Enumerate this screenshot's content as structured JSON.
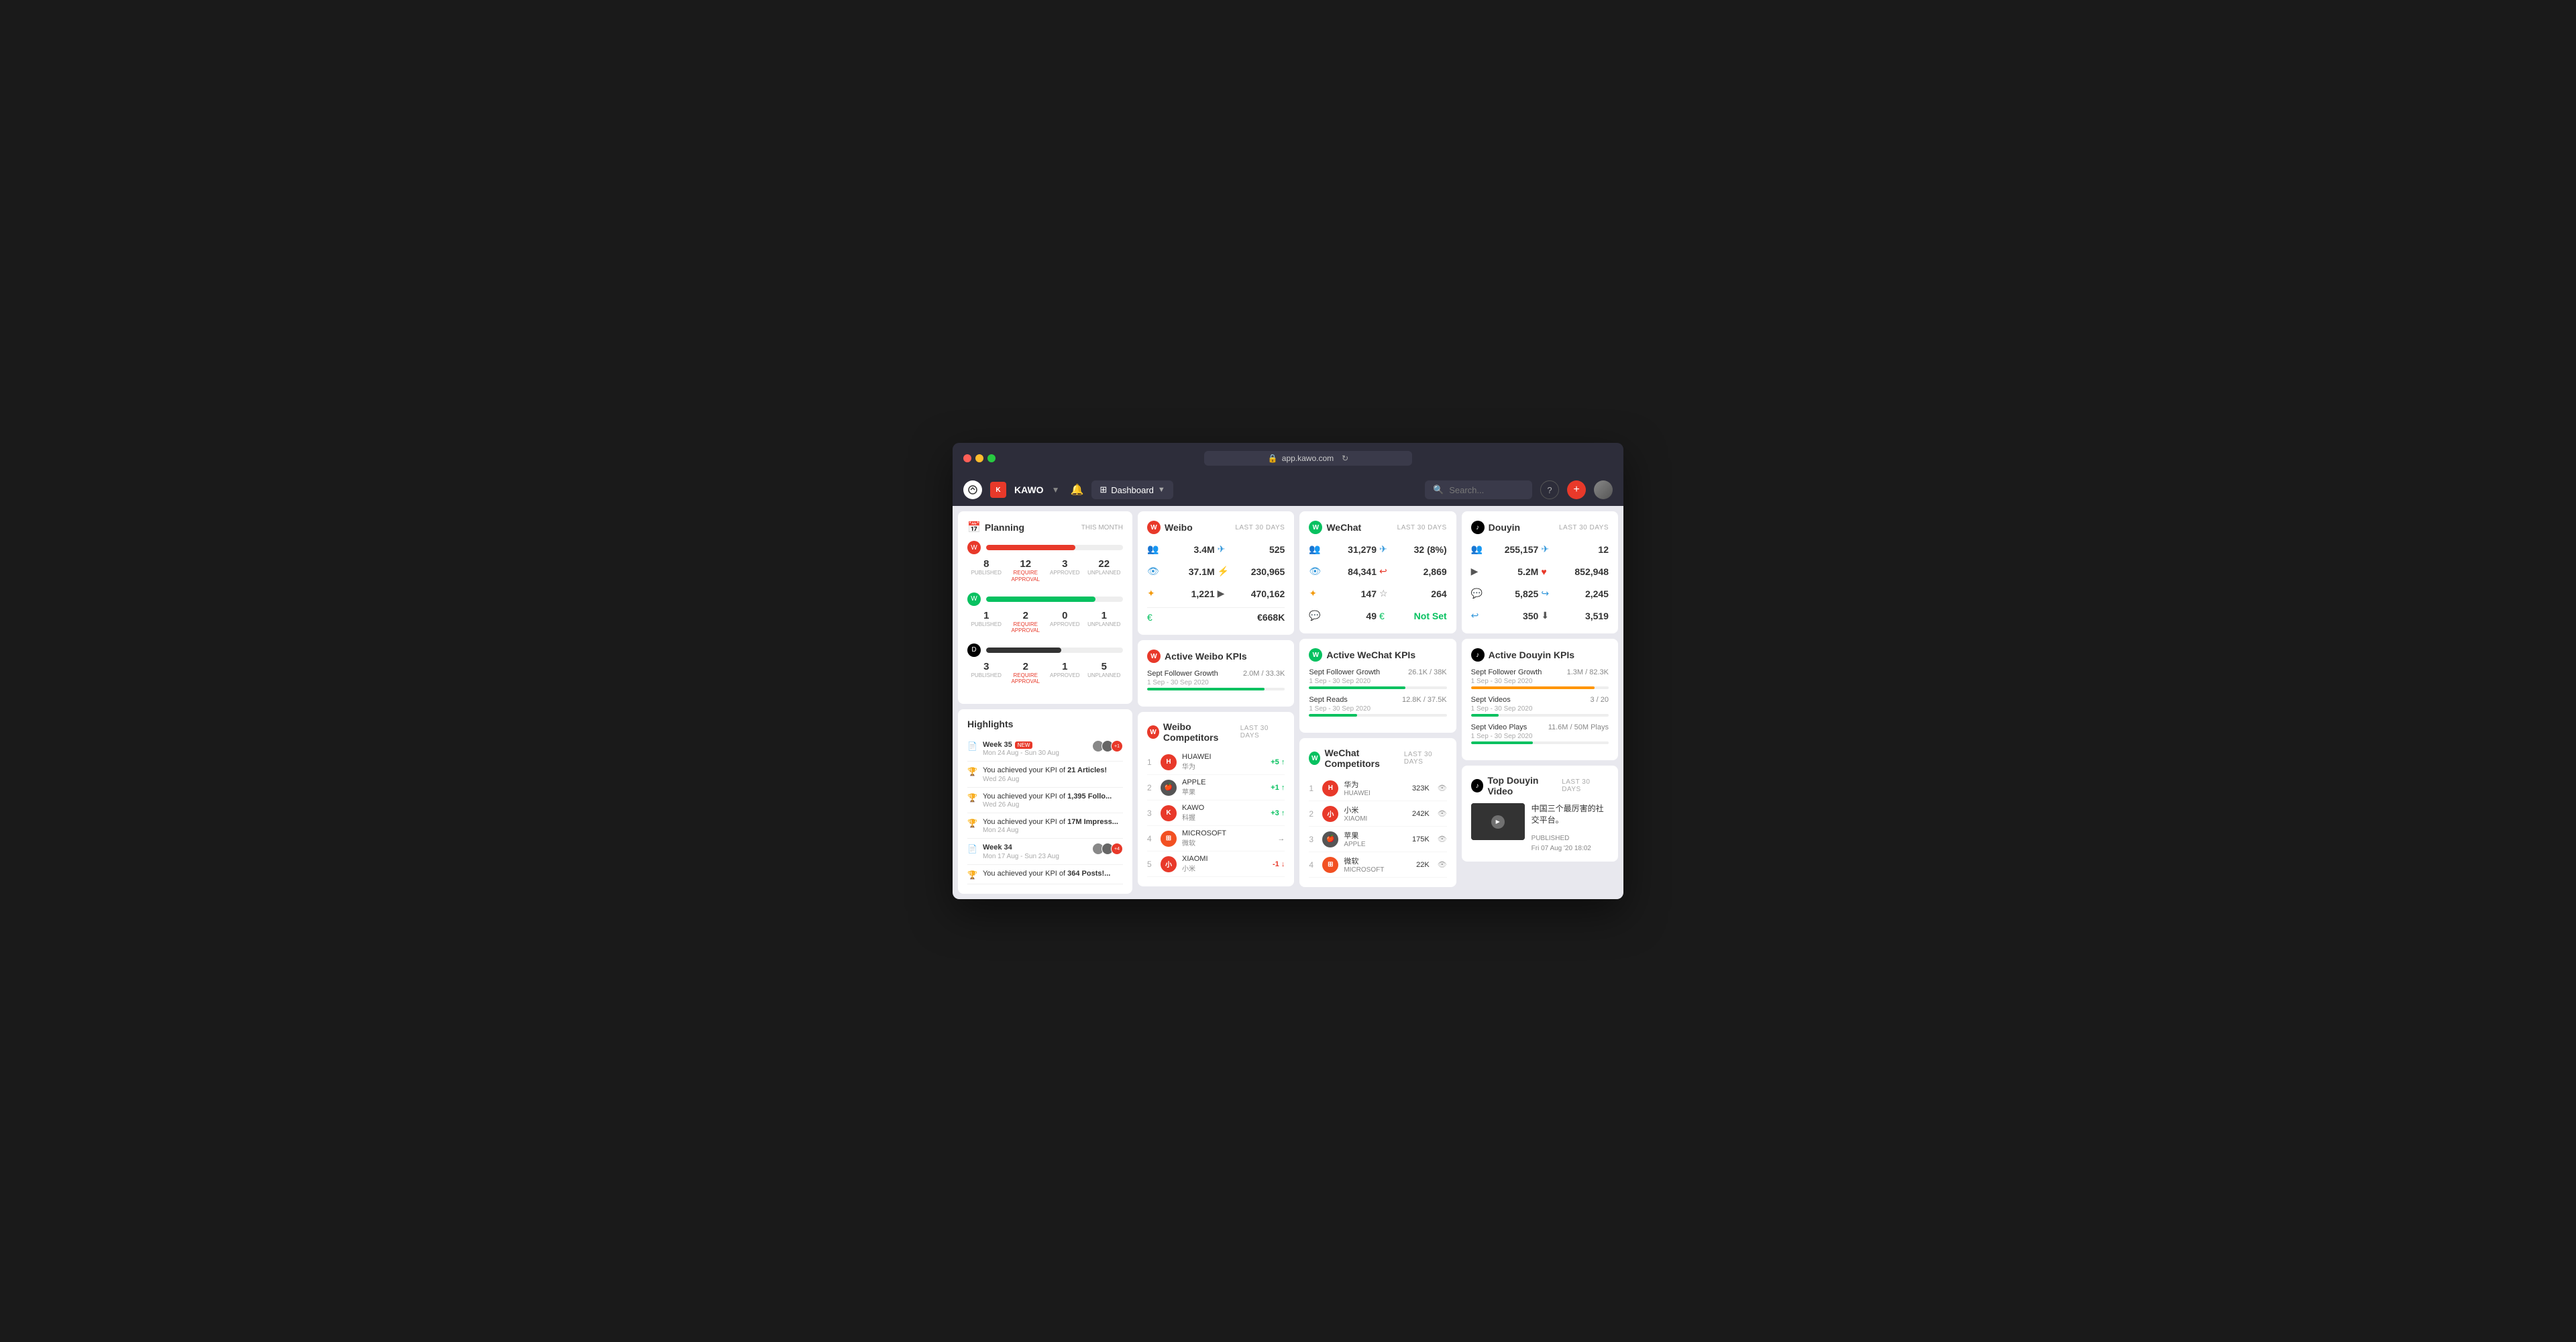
{
  "browser": {
    "url": "app.kawo.com",
    "tab_title": "Dashboard"
  },
  "nav": {
    "brand": "KAWO",
    "dashboard_label": "Dashboard",
    "search_placeholder": "Search...",
    "add_label": "+",
    "help_label": "?"
  },
  "planning": {
    "title": "Planning",
    "period": "THIS MONTH",
    "platforms": [
      {
        "name": "weibo",
        "progress": 65,
        "color": "#e8392a",
        "published": "8",
        "require_approval": "12",
        "approved": "3",
        "unplanned": "22"
      },
      {
        "name": "wechat",
        "progress": 80,
        "color": "#07c160",
        "published": "1",
        "require_approval": "2",
        "approved": "0",
        "unplanned": "1"
      },
      {
        "name": "douyin",
        "progress": 55,
        "color": "#000000",
        "published": "3",
        "require_approval": "2",
        "approved": "1",
        "unplanned": "5"
      }
    ],
    "labels": {
      "published": "PUBLISHED",
      "require_approval": "REQUIRE APPROVAL",
      "approved": "APPROVED",
      "unplanned": "UNPLANNED"
    }
  },
  "highlights": {
    "title": "Highlights",
    "items": [
      {
        "type": "doc",
        "text": "Week 35",
        "badge": "NEW",
        "date": "Mon 24 Aug - Sun 30 Aug",
        "has_avatars": true,
        "extra": "+1"
      },
      {
        "type": "trophy",
        "text": "You achieved your KPI of 21 Articles!",
        "date": "Wed 26 Aug"
      },
      {
        "type": "trophy",
        "text": "You achieved your KPI of 1,395 Follo...",
        "date": "Wed 26 Aug"
      },
      {
        "type": "trophy",
        "text": "You achieved your KPI of 17M Impress...",
        "date": "Mon 24 Aug"
      },
      {
        "type": "doc",
        "text": "Week 34",
        "date": "Mon 17 Aug - Sun 23 Aug",
        "has_avatars": true,
        "extra": "+4"
      },
      {
        "type": "trophy",
        "text": "You achieved your KPI of 364 Posts!...",
        "date": ""
      }
    ]
  },
  "weibo": {
    "title": "Weibo",
    "period": "LAST 30 DAYS",
    "followers": "3.4M",
    "reach": "525",
    "views": "37.1M",
    "interactions": "230,965",
    "posts": "1,221",
    "video_views": "470,162",
    "cost": "€668K"
  },
  "wechat": {
    "title": "WeChat",
    "period": "LAST 30 DAYS",
    "followers": "31,279",
    "reach": "32 (8%)",
    "views": "84,341",
    "interactions": "2,869",
    "posts": "147",
    "saves": "264",
    "comments": "49",
    "cost": "Not Set"
  },
  "douyin": {
    "title": "Douyin",
    "period": "LAST 30 DAYS",
    "followers": "255,157",
    "reach": "12",
    "video_views": "5.2M",
    "likes": "852,948",
    "comments": "5,825",
    "shares": "2,245",
    "reposts": "350",
    "downloads": "3,519"
  },
  "active_weibo_kpis": {
    "title": "Active Weibo KPIs",
    "kpis": [
      {
        "name": "Sept Follower Growth",
        "dates": "1 Sep - 30 Sep 2020",
        "value": "2.0M / 33.3K",
        "progress": 85,
        "color": "green"
      }
    ]
  },
  "active_wechat_kpis": {
    "title": "Active WeChat KPIs",
    "kpis": [
      {
        "name": "Sept Follower Growth",
        "dates": "1 Sep - 30 Sep 2020",
        "value": "26.1K / 38K",
        "progress": 70,
        "color": "green"
      },
      {
        "name": "Sept Reads",
        "dates": "1 Sep - 30 Sep 2020",
        "value": "12.8K / 37.5K",
        "progress": 35,
        "color": "green"
      }
    ]
  },
  "active_douyin_kpis": {
    "title": "Active Douyin KPIs",
    "kpis": [
      {
        "name": "Sept Follower Growth",
        "dates": "1 Sep - 30 Sep 2020",
        "value": "1.3M / 82.3K",
        "progress": 90,
        "color": "orange"
      },
      {
        "name": "Sept Videos",
        "dates": "1 Sep - 30 Sep 2020",
        "value": "3 / 20",
        "progress": 20,
        "color": "green"
      },
      {
        "name": "Sept Video Plays",
        "dates": "1 Sep - 30 Sep 2020",
        "value": "11.6M / 50M Plays",
        "progress": 45,
        "color": "green"
      }
    ]
  },
  "weibo_competitors": {
    "title": "Weibo Competitors",
    "period": "LAST 30 DAYS",
    "items": [
      {
        "rank": "1",
        "name": "HUAWEI",
        "name_zh": "华为",
        "color": "#e8392a",
        "change": "+5",
        "direction": "up"
      },
      {
        "rank": "2",
        "name": "APPLE",
        "name_zh": "苹果",
        "color": "#555",
        "change": "+1",
        "direction": "up"
      },
      {
        "rank": "3",
        "name": "KAWO",
        "name_zh": "科握",
        "color": "#e8392a",
        "change": "+3",
        "direction": "up"
      },
      {
        "rank": "4",
        "name": "MICROSOFT",
        "name_zh": "微软",
        "color": "#f25022",
        "change": "→",
        "direction": "neutral"
      },
      {
        "rank": "5",
        "name": "XIAOMI",
        "name_zh": "小米",
        "color": "#e8392a",
        "change": "-1",
        "direction": "down"
      }
    ]
  },
  "wechat_competitors": {
    "title": "WeChat Competitors",
    "period": "LAST 30 DAYS",
    "items": [
      {
        "rank": "1",
        "name": "华为",
        "name_en": "HUAWEI",
        "views": "323K"
      },
      {
        "rank": "2",
        "name": "小米",
        "name_en": "XIAOMI",
        "views": "242K"
      },
      {
        "rank": "3",
        "name": "苹果",
        "name_en": "APPLE",
        "views": "175K"
      },
      {
        "rank": "4",
        "name": "微软",
        "name_en": "MICROSOFT",
        "views": "22K"
      }
    ]
  },
  "top_douyin_video": {
    "title": "Top Douyin Video",
    "period": "LAST 30 DAYS",
    "description": "中国三个最厉害的社交平台。",
    "status": "PUBLISHED",
    "date": "Fri 07 Aug '20 18:02"
  }
}
